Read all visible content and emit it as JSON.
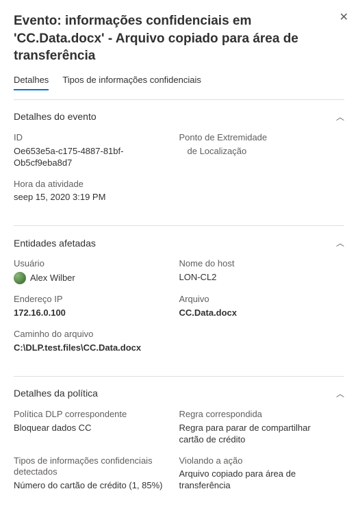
{
  "header": {
    "title": "Evento: informações confidenciais em 'CC.Data.docx' - Arquivo copiado para área de transferência"
  },
  "tabs": {
    "details": "Detalhes",
    "sensitive_types": "Tipos de informações confidenciais"
  },
  "sections": {
    "event_details": {
      "title": "Detalhes do evento",
      "id_label": "ID",
      "id_value": "Oe653e5a-c175-4887-81bf-Ob5cf9eba8d7",
      "endpoint_label": "Ponto de Extremidade",
      "location_label": "de Localização",
      "time_label": "Hora da atividade",
      "time_value": "seep 15, 2020 3:19 PM"
    },
    "affected": {
      "title": "Entidades afetadas",
      "user_label": "Usuário",
      "user_value": "Alex Wilber",
      "host_label": "Nome do host",
      "host_value": "LON-CL2",
      "ip_label": "Endereço IP",
      "ip_value": "172.16.0.100",
      "file_label": "Arquivo",
      "file_value": "CC.Data.docx",
      "path_label": "Caminho do arquivo",
      "path_value": "C:\\DLP.test.files\\CC.Data.docx"
    },
    "policy": {
      "title": "Detalhes da política",
      "policy_label": "Política DLP correspondente",
      "policy_value": "Bloquear dados CC",
      "rule_label": "Regra correspondida",
      "rule_value": "Regra para parar de compartilhar cartão de crédito",
      "types_label": "Tipos de informações confidenciais detectados",
      "types_value": "Número do cartão de crédito (1, 85%)",
      "action_label": "Violando a ação",
      "action_value": "Arquivo copiado para área de transferência"
    }
  }
}
